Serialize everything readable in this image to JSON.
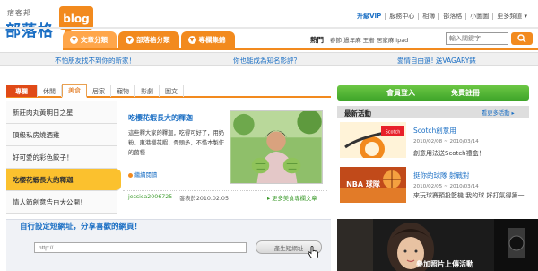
{
  "header": {
    "logo_sub": "痞客邦",
    "logo_main": "部落格",
    "logo_badge": "blog",
    "top_links": [
      "升級VIP",
      "服務中心",
      "相簿",
      "部落格",
      "小圖圖",
      "更多頻道 ▾"
    ],
    "nav_tabs": [
      "文章分類",
      "部落格分類",
      "專欄集錦"
    ],
    "hot_label": "熱門",
    "hot_words": "春節 過年麻 王者 居家麻 ipad",
    "search_placeholder": "輸入關鍵字"
  },
  "promo": {
    "left": "不怕朋友找不到你的新家！",
    "middle": "你也能成為知名影評？",
    "right": "愛情自由選! 送VAGARY錶"
  },
  "content": {
    "tabs": [
      "專欄",
      "休閒",
      "美食",
      "居家",
      "寵物",
      "影劇",
      "圖文"
    ],
    "active_tab": "美食",
    "list": [
      "新莊肉丸黃明日之星",
      "頂級私房燒酒雞",
      "好可愛的彩色餃子！",
      "吃櫻花蝦長大的釋迦",
      "情人節創意告白大公開！"
    ],
    "selected_index": 3,
    "article": {
      "title": "吃櫻花蝦長大的釋迦",
      "body": "這些釋大家的釋迦，吃得可好了，用奶粉、東港櫻花蝦、骨頭多，不惜本製作的菌種",
      "more": "繼續閱讀",
      "author": "jessica2006725",
      "date": "發表於2010.02.05",
      "more2": "▸ 更多美食專欄文章"
    }
  },
  "urlbar": {
    "title": "自行設定短網址，分享喜歡的網頁！",
    "input_placeholder": "http://",
    "button": "產生短網址"
  },
  "side": {
    "login": "會員登入",
    "signup": "免費註冊",
    "activity_title": "最新活動",
    "activity_more": "看更多活動 ▸",
    "activities": [
      {
        "title": "Scotch創意用",
        "date": "2010/02/08 ~ 2010/03/14",
        "desc": "創意用法送Scotch禮盒！",
        "img_text": "Scotch"
      },
      {
        "title": "挺你的球隊 射戰對",
        "date": "2010/02/05 ~ 2010/03/14",
        "desc": "來玩球賽預投籃機 我的球 好打氣得第一",
        "img_text": "NBA 球隊"
      }
    ],
    "photo_caption": "參加照片上傳活動"
  },
  "colors": {
    "brand_blue": "#1b6fc4",
    "orange": "#f28a1e",
    "green": "#3fa52a"
  }
}
